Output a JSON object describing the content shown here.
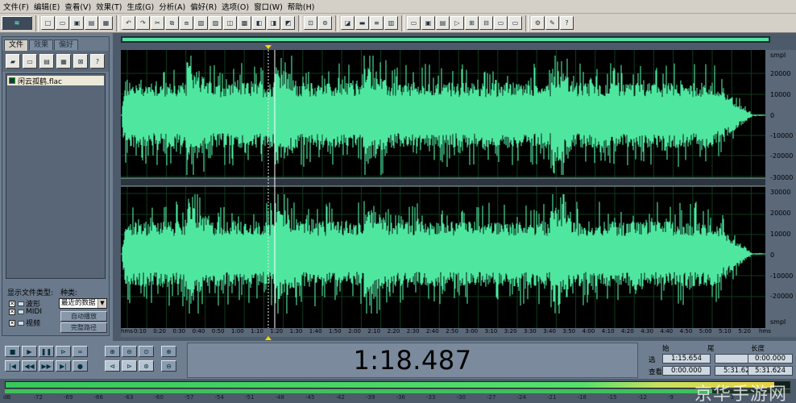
{
  "menu": [
    "文件(F)",
    "编辑(E)",
    "查看(V)",
    "效果(T)",
    "生成(G)",
    "分析(A)",
    "偏好(R)",
    "选项(O)",
    "窗口(W)",
    "帮助(H)"
  ],
  "left_panel": {
    "tabs": [
      "文件",
      "效果",
      "偏好"
    ],
    "file_item": "闲云孤鹤.flac",
    "file_type_label": "显示文件类型:",
    "kind_label": "种类:",
    "checkboxes": [
      "波形",
      "MIDI",
      "视频"
    ],
    "kind_select": "最近的数据",
    "buttons": [
      "自动播放",
      "完整路径"
    ]
  },
  "editor": {
    "channel1_scale": [
      "smpl",
      "20000",
      "10000",
      "0",
      "-10000",
      "-20000",
      "-30000"
    ],
    "channel2_scale": [
      "30000",
      "20000",
      "10000",
      "0",
      "-10000",
      "-20000",
      "smpl"
    ],
    "time_ruler": [
      "hms",
      "0:10",
      "0:20",
      "0:30",
      "0:40",
      "0:50",
      "1:00",
      "1:10",
      "1:20",
      "1:30",
      "1:40",
      "1:50",
      "2:00",
      "2:10",
      "2:20",
      "2:30",
      "2:40",
      "2:50",
      "3:00",
      "3:10",
      "3:20",
      "3:30",
      "3:40",
      "3:50",
      "4:00",
      "4:10",
      "4:20",
      "4:30",
      "4:40",
      "4:50",
      "5:00",
      "5:10",
      "5:20",
      "hms"
    ],
    "waveform_color": "#4fe7a0",
    "cursor_color": "#e8e8e8"
  },
  "transport": {
    "current_time": "1:18.487"
  },
  "selection": {
    "headers": [
      "始",
      "尾",
      "长度"
    ],
    "rows": [
      {
        "label": "选",
        "begin": "1:15.654",
        "end": "",
        "length": "0:00.000"
      },
      {
        "label": "查看",
        "begin": "0:00.000",
        "end": "5:31.624",
        "length": "5:31.624"
      }
    ]
  },
  "meter": {
    "scale": [
      "dB",
      "-72",
      "-69",
      "-66",
      "-63",
      "-60",
      "-57",
      "-54",
      "-51",
      "-48",
      "-45",
      "-42",
      "-39",
      "-36",
      "-33",
      "-30",
      "-27",
      "-24",
      "-21",
      "-18",
      "-15",
      "-12",
      "-9",
      "-6",
      "-3",
      "0"
    ],
    "watermark": "京华手游网"
  }
}
